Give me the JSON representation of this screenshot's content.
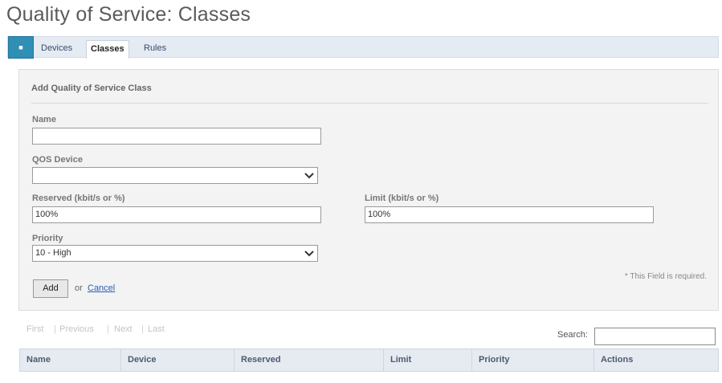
{
  "page_title": "Quality of Service: Classes",
  "tabs": {
    "home_icon": "home-icon",
    "items": [
      {
        "label": "Devices"
      },
      {
        "label": "Classes",
        "active": true
      },
      {
        "label": "Rules"
      }
    ]
  },
  "form": {
    "title": "Add Quality of Service Class",
    "name_label": "Name",
    "name_value": "",
    "device_label": "QOS Device",
    "device_value": "",
    "reserved_label": "Reserved (kbit/s or %)",
    "reserved_value": "100%",
    "limit_label": "Limit (kbit/s or %)",
    "limit_value": "100%",
    "priority_label": "Priority",
    "priority_value": "10 - High",
    "add_label": "Add",
    "or_text": "or",
    "cancel_label": "Cancel",
    "required_note": "* This Field is required."
  },
  "pager": {
    "first": "First",
    "previous": "Previous",
    "next": "Next",
    "last": "Last"
  },
  "search": {
    "label": "Search:",
    "value": ""
  },
  "table": {
    "columns": [
      "Name",
      "Device",
      "Reserved",
      "Limit",
      "Priority",
      "Actions"
    ]
  },
  "colors": {
    "accent": "#2f8fb4",
    "link": "#2a5db0",
    "header_bg": "#e6ebf2"
  }
}
